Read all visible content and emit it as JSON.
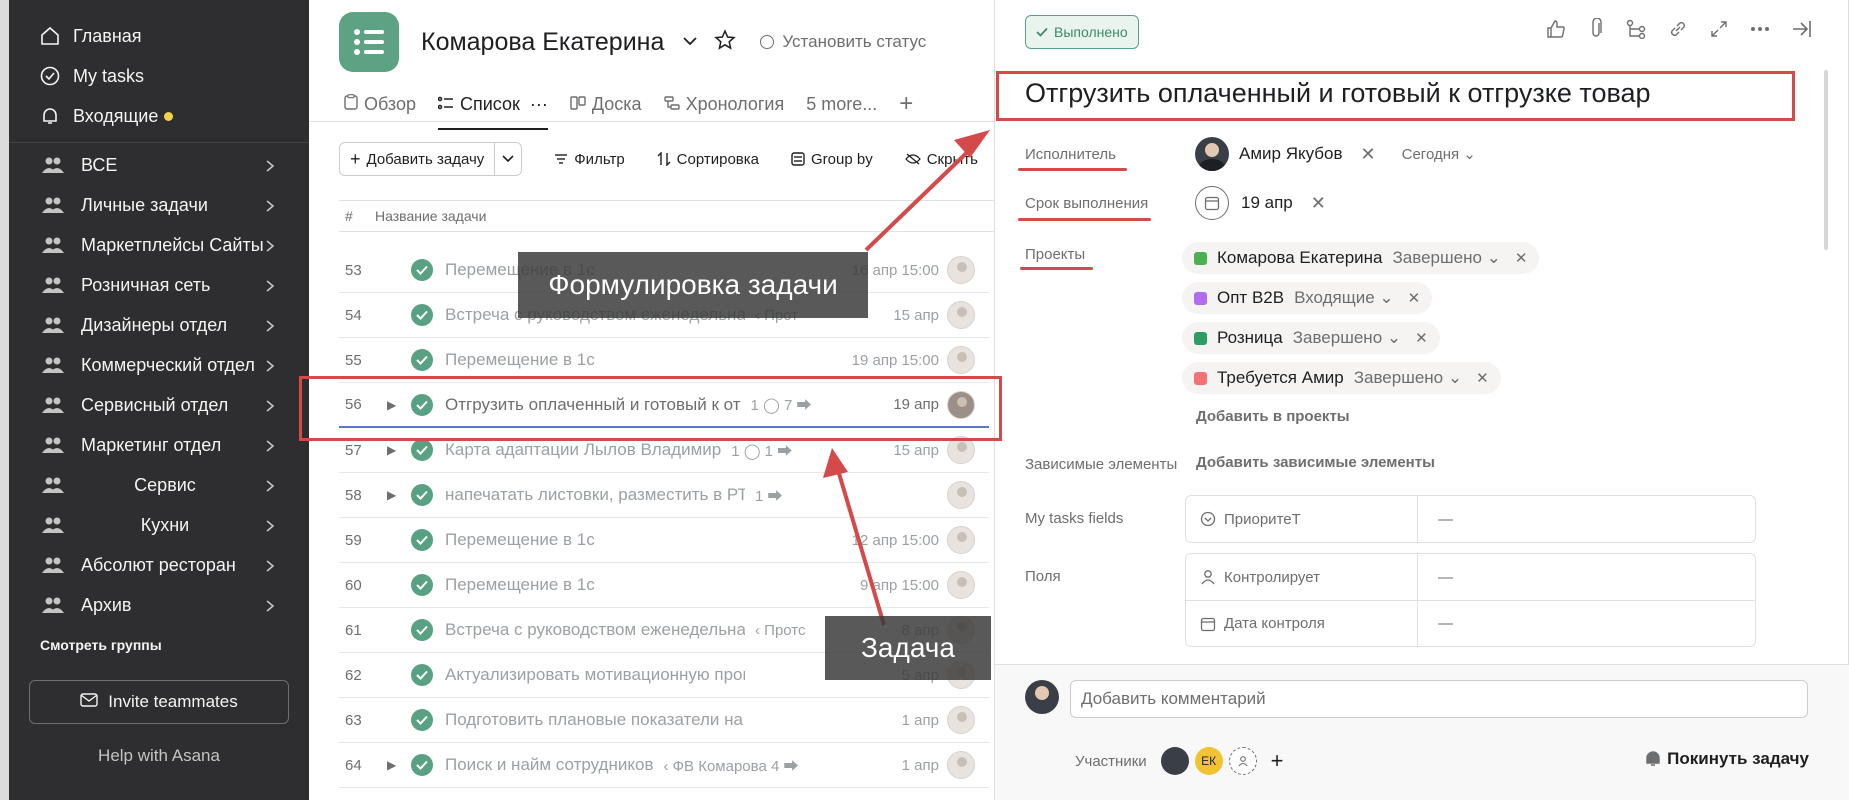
{
  "sidebar": {
    "nav": [
      {
        "label": "Главная",
        "icon": "home-icon"
      },
      {
        "label": "My tasks",
        "icon": "check-circle-icon"
      },
      {
        "label": "Входящие",
        "icon": "bell-icon"
      }
    ],
    "teams": [
      {
        "label": "ВСЕ"
      },
      {
        "label": "Личные задачи"
      },
      {
        "label": "Маркетплейсы Сайты"
      },
      {
        "label": "Розничная сеть"
      },
      {
        "label": "Дизайнеры отдел"
      },
      {
        "label": "Коммерческий отдел"
      },
      {
        "label": "Сервисный отдел"
      },
      {
        "label": "Маркетинг отдел"
      },
      {
        "label": "Сервис"
      },
      {
        "label": "Кухни"
      },
      {
        "label": "Абсолют ресторан"
      },
      {
        "label": "Архив"
      }
    ],
    "see_groups": "Смотреть группы",
    "invite": "Invite teammates",
    "help": "Help with Asana"
  },
  "project": {
    "title": "Комарова Екатерина",
    "set_status": "Установить статус",
    "tabs": [
      "Обзор",
      "Список",
      "Доска",
      "Хронология",
      "5 more..."
    ],
    "active_tab": "Список",
    "toolbar": {
      "add_task": "Добавить задачу",
      "filter": "Фильтр",
      "sort": "Сортировка",
      "group_by": "Group by",
      "hide": "Скрыть"
    },
    "columns": {
      "num": "#",
      "name": "Название задачи"
    },
    "rows": [
      {
        "num": "53",
        "name": "Перемещение в 1с",
        "extra": "",
        "date": "16 апр 15:00"
      },
      {
        "num": "54",
        "name": "Встреча с руководством еженедельная",
        "extra": "‹ Прот",
        "date": "15 апр"
      },
      {
        "num": "55",
        "name": "Перемещение в 1с",
        "extra": "",
        "date": "19 апр 15:00"
      },
      {
        "num": "56",
        "name": "Отгрузить оплаченный и готовый к от",
        "extra": "1 ◯  7 ⮕",
        "date": "19 апр"
      },
      {
        "num": "57",
        "name": "Карта адаптации Лылов Владимир",
        "extra": "1 ◯  1 ⮕",
        "date": "15 апр"
      },
      {
        "num": "58",
        "name": "напечатать листовки, разместить в РТТ, трансляр",
        "extra": "1 ⮕",
        "date": ""
      },
      {
        "num": "59",
        "name": "Перемещение в 1с",
        "extra": "",
        "date": "12 апр 15:00"
      },
      {
        "num": "60",
        "name": "Перемещение в  1с",
        "extra": "",
        "date": "9 апр 15:00"
      },
      {
        "num": "61",
        "name": "Встреча с руководством еженедельная",
        "extra": "‹ Протс",
        "date": "8 апр"
      },
      {
        "num": "62",
        "name": "Актуализировать мотивационную программу",
        "extra": "",
        "date": "5 апр"
      },
      {
        "num": "63",
        "name": "Подготовить плановые показатели на следующ",
        "extra": "",
        "date": "1 апр"
      },
      {
        "num": "64",
        "name": "Поиск и найм сотрудников",
        "extra": "‹ ФВ Комарова   4 ⮕",
        "date": "1 апр"
      }
    ]
  },
  "detail": {
    "status_badge": "Выполнено",
    "title": "Отгрузить оплаченный и готовый к отгрузке товар",
    "assignee_label": "Исполнитель",
    "assignee": "Амир Якубов",
    "assignee_when": "Сегодня",
    "due_label": "Срок выполнения",
    "due": "19 апр",
    "projects_label": "Проекты",
    "projects": [
      {
        "name": "Комарова Екатерина",
        "status": "Завершено",
        "color": "#4caf50"
      },
      {
        "name": "Опт B2B",
        "status": "Входящие",
        "color": "#b26cf0"
      },
      {
        "name": "Розница",
        "status": "Завершено",
        "color": "#2e9d63"
      },
      {
        "name": "Требуется Амир",
        "status": "Завершено",
        "color": "#f27374"
      }
    ],
    "add_projects": "Добавить в проекты",
    "deps_label": "Зависимые элементы",
    "deps_add": "Добавить зависимые элементы",
    "my_tasks_fields_label": "My tasks fields",
    "priority_label": "ПриоритеТ",
    "priority_value": "—",
    "fields_label": "Поля",
    "controller_label": "Контролирует",
    "controller_value": "—",
    "control_date_label": "Дата контроля",
    "control_date_value": "—",
    "comment_placeholder": "Добавить комментарий",
    "members_label": "Участники",
    "member_initials": "ЕК",
    "leave": "Покинуть задачу"
  },
  "annotations": {
    "task_wording": "Формулировка задачи",
    "task": "Задача",
    "color": "#d44a4a"
  }
}
